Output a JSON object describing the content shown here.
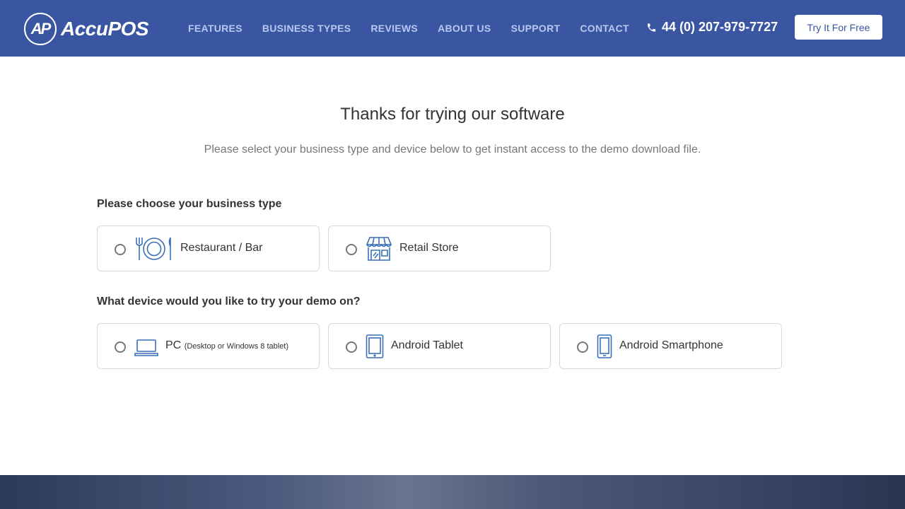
{
  "header": {
    "logo_badge": "AP",
    "logo_text": "AccuPOS",
    "nav": [
      "FEATURES",
      "BUSINESS TYPES",
      "REVIEWS",
      "ABOUT US",
      "SUPPORT",
      "CONTACT"
    ],
    "phone": "44 (0) 207-979-7727",
    "cta": "Try It For Free",
    "bg_color": "#3a56a3"
  },
  "main": {
    "title": "Thanks for trying our software",
    "subtitle": "Please select your business type and device below to get instant access to the demo download file.",
    "business_label": "Please choose your business type",
    "business_options": [
      {
        "label": "Restaurant / Bar",
        "icon": "fork-plate-knife-icon"
      },
      {
        "label": "Retail Store",
        "icon": "storefront-icon"
      }
    ],
    "device_label": "What device would you like to try your demo on?",
    "device_options": [
      {
        "label": "PC",
        "note": "(Desktop or Windows 8 tablet)",
        "icon": "laptop-icon"
      },
      {
        "label": "Android Tablet",
        "icon": "tablet-icon"
      },
      {
        "label": "Android Smartphone",
        "icon": "smartphone-icon"
      }
    ]
  }
}
